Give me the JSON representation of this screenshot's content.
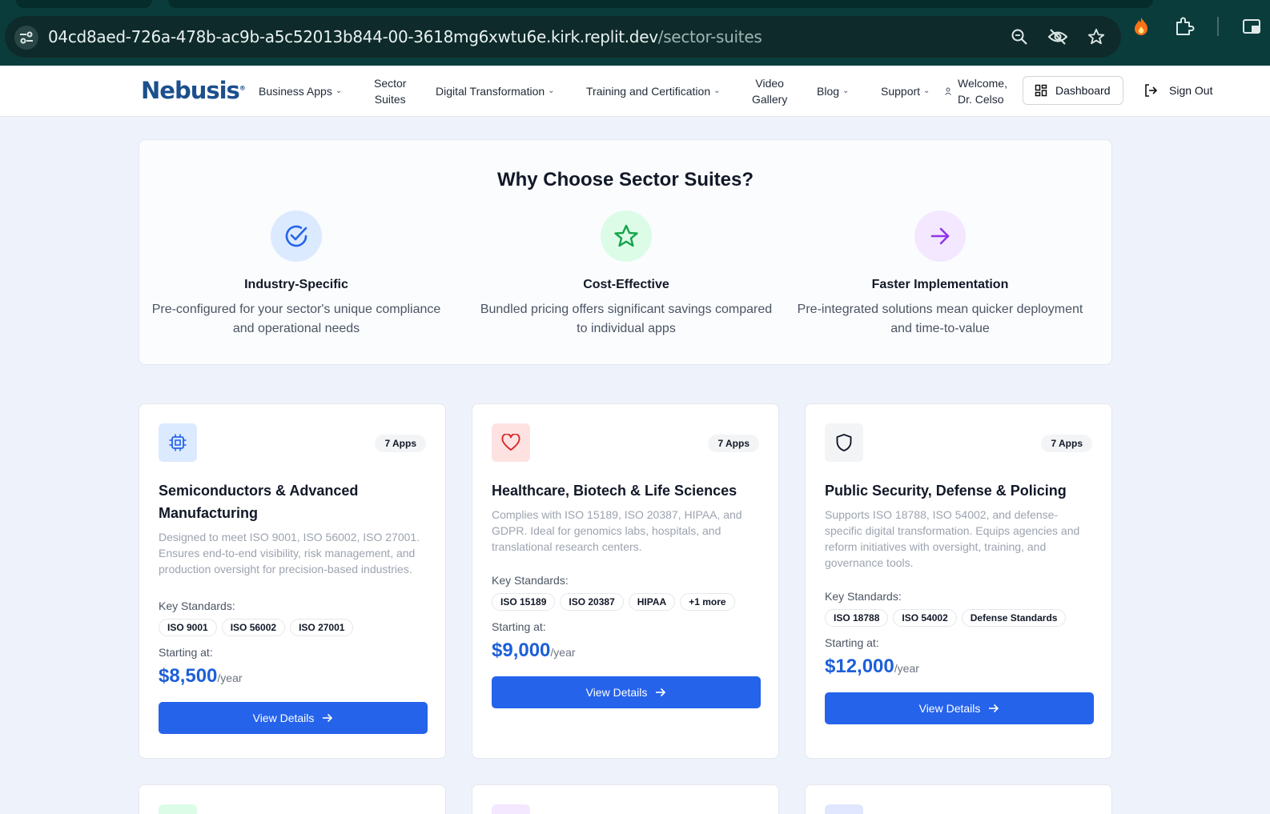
{
  "browser": {
    "url_host": "04cd8aed-726a-478b-ac9b-a5c52013b844-00-3618mg6xwtu6e.kirk.replit.dev",
    "url_path": "/sector-suites",
    "icons": [
      "site-info-icon",
      "zoom-icon",
      "eye-off-icon",
      "star-icon",
      "fire-icon",
      "extensions-icon",
      "split-view-icon"
    ]
  },
  "header": {
    "logo": "Nebusis",
    "nav": [
      {
        "label": "Business Apps",
        "dropdown": true
      },
      {
        "label_line1": "Sector",
        "label_line2": "Suites",
        "dropdown": false
      },
      {
        "label": "Digital Transformation",
        "dropdown": true
      },
      {
        "label": "Training and Certification",
        "dropdown": true
      },
      {
        "label_line1": "Video",
        "label_line2": "Gallery",
        "dropdown": false
      },
      {
        "label": "Blog",
        "dropdown": true
      },
      {
        "label": "Support",
        "dropdown": true
      }
    ],
    "welcome_line1": "Welcome,",
    "welcome_line2": "Dr. Celso",
    "dashboard_label": "Dashboard",
    "signout_label": "Sign Out"
  },
  "why": {
    "title": "Why Choose Sector Suites?",
    "features": [
      {
        "icon": "check-circle-icon",
        "color": "#2563eb",
        "bg": "#dbeafe",
        "title": "Industry-Specific",
        "desc_line1": "Pre-configured for your sector's unique compliance",
        "desc_line2": "and operational needs"
      },
      {
        "icon": "star-icon",
        "color": "#16a34a",
        "bg": "#dcfce7",
        "title": "Cost-Effective",
        "desc_line1": "Bundled pricing offers significant savings compared",
        "desc_line2": "to individual apps"
      },
      {
        "icon": "arrow-right-icon",
        "color": "#9333ea",
        "bg": "#f3e8ff",
        "title": "Faster Implementation",
        "desc_line1": "Pre-integrated solutions mean quicker deployment",
        "desc_line2": "and time-to-value"
      }
    ]
  },
  "suites": [
    {
      "icon": "cpu-chip-icon",
      "icon_color": "#2563eb",
      "icon_bg": "#dbeafe",
      "apps_badge": "7 Apps",
      "title": "Semiconductors & Advanced Manufacturing",
      "desc": "Designed to meet ISO 9001, ISO 56002, ISO 27001. Ensures end-to-end visibility, risk management, and production oversight for precision-based industries.",
      "key_standards_label": "Key Standards:",
      "standards": [
        "ISO 9001",
        "ISO 56002",
        "ISO 27001"
      ],
      "starting_label": "Starting at:",
      "price": "$8,500",
      "per": "/year",
      "button": "View Details"
    },
    {
      "icon": "heart-icon",
      "icon_color": "#dc2626",
      "icon_bg": "#fee2e2",
      "apps_badge": "7 Apps",
      "title": "Healthcare, Biotech & Life Sciences",
      "desc": "Complies with ISO 15189, ISO 20387, HIPAA, and GDPR. Ideal for genomics labs, hospitals, and translational research centers.",
      "key_standards_label": "Key Standards:",
      "standards": [
        "ISO 15189",
        "ISO 20387",
        "HIPAA",
        "+1 more"
      ],
      "starting_label": "Starting at:",
      "price": "$9,000",
      "per": "/year",
      "button": "View Details"
    },
    {
      "icon": "shield-icon",
      "icon_color": "#111827",
      "icon_bg": "#f3f4f6",
      "apps_badge": "7 Apps",
      "title": "Public Security, Defense & Policing",
      "desc": "Supports ISO 18788, ISO 54002, and defense-specific digital transformation. Equips agencies and reform initiatives with oversight, training, and governance tools.",
      "key_standards_label": "Key Standards:",
      "standards": [
        "ISO 18788",
        "ISO 54002",
        "Defense Standards"
      ],
      "starting_label": "Starting at:",
      "price": "$12,000",
      "per": "/year",
      "button": "View Details"
    }
  ],
  "peek_colors": [
    "#dcfce7",
    "#f3e8ff",
    "#e0e7ff"
  ]
}
